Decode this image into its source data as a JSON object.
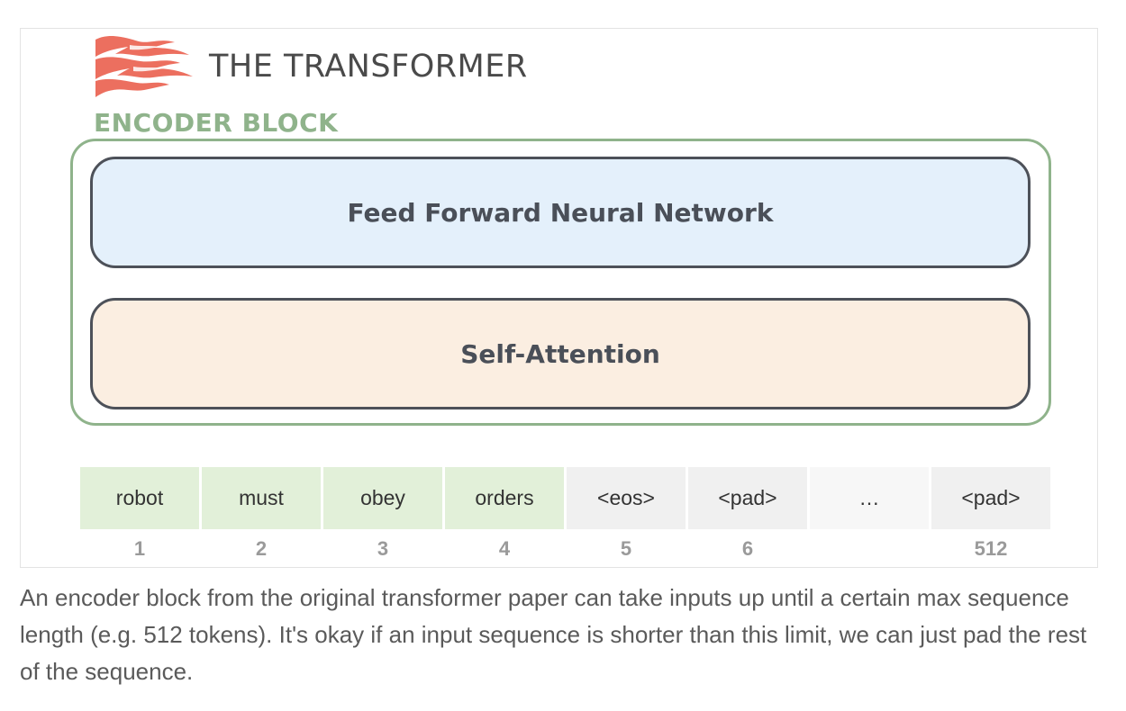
{
  "header": {
    "title": "THE TRANSFORMER",
    "logo_icon": "flame-logo-icon"
  },
  "encoder": {
    "label": "ENCODER BLOCK",
    "layers": [
      {
        "name": "Feed Forward Neural Network",
        "fill": "#e4f0fb"
      },
      {
        "name": "Self-Attention",
        "fill": "#fbeee1"
      }
    ],
    "accent_color": "#8fb38b"
  },
  "tokens": {
    "cells": [
      {
        "text": "robot",
        "index": "1",
        "kind": "word"
      },
      {
        "text": "must",
        "index": "2",
        "kind": "word"
      },
      {
        "text": "obey",
        "index": "3",
        "kind": "word"
      },
      {
        "text": "orders",
        "index": "4",
        "kind": "word"
      },
      {
        "text": "<eos>",
        "index": "5",
        "kind": "special"
      },
      {
        "text": "<pad>",
        "index": "6",
        "kind": "special"
      },
      {
        "text": "…",
        "index": "",
        "kind": "ellipsis"
      },
      {
        "text": "<pad>",
        "index": "512",
        "kind": "special"
      }
    ],
    "colors": {
      "word": "#e2f0d9",
      "special": "#f0f0f0",
      "ellipsis": "#f7f7f7"
    }
  },
  "caption": "An encoder block from the original transformer paper can take inputs up until a certain max sequence length (e.g. 512 tokens). It's okay if an input sequence is shorter than this limit, we can just pad the rest of the sequence."
}
